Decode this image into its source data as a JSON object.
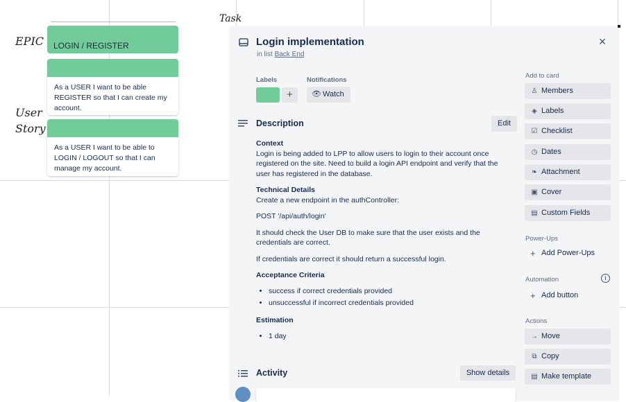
{
  "board": {
    "annotations": {
      "epic": "EPIC",
      "user_story_1": "User",
      "user_story_2": "Story",
      "task": "Task"
    },
    "epic_card": {
      "title": "LOGIN / REGISTER"
    },
    "story_cards": [
      {
        "text": "As a USER I want to be able REGISTER so that I can create my account."
      },
      {
        "text": "As a USER I want to be able to LOGIN / LOGOUT so that I can manage my account."
      }
    ]
  },
  "card": {
    "title": "Login implementation",
    "list_prefix": "in list",
    "list_name": "Back End",
    "labels_heading": "Labels",
    "notifications_heading": "Notifications",
    "add_label": "+",
    "watch_label": "Watch",
    "description_heading": "Description",
    "edit_label": "Edit",
    "description": {
      "context_heading": "Context",
      "context_text": "Login is being added to LPP to allow users to login to their account once registered on the site. Need to build a login API endpoint and verify that the user has registered in the database.",
      "technical_heading": "Technical Details",
      "technical_text": "Create a new endpoint in the authController:",
      "endpoint": "POST '/api/auth/login'",
      "check_text": "It should check the User DB to make sure that the user exists and the credentials are correct.",
      "success_text": "If credentials are correct it should return a successful login.",
      "acceptance_heading": "Acceptance Criteria",
      "acceptance_items": [
        "success if correct credentials provided",
        "unsuccessful if incorrect credentials provided"
      ],
      "estimation_heading": "Estimation",
      "estimation_items": [
        "1 day"
      ]
    },
    "activity_heading": "Activity",
    "show_details": "Show details",
    "close": "×"
  },
  "sidebar": {
    "add_to_card": "Add to card",
    "add_buttons": [
      {
        "label": "Members",
        "icon": "person-icon"
      },
      {
        "label": "Labels",
        "icon": "tag-icon"
      },
      {
        "label": "Checklist",
        "icon": "checkbox-icon"
      },
      {
        "label": "Dates",
        "icon": "clock-icon"
      },
      {
        "label": "Attachment",
        "icon": "paperclip-icon"
      },
      {
        "label": "Cover",
        "icon": "card-icon"
      },
      {
        "label": "Custom Fields",
        "icon": "fields-icon"
      }
    ],
    "powerups_heading": "Power-Ups",
    "add_powerups": "Add Power-Ups",
    "automation_heading": "Automation",
    "add_button": "Add button",
    "actions_heading": "Actions",
    "actions": [
      {
        "label": "Move",
        "icon": "arrow-right-icon"
      },
      {
        "label": "Copy",
        "icon": "copy-icon"
      },
      {
        "label": "Make template",
        "icon": "template-icon"
      }
    ]
  },
  "colors": {
    "label_green": "#72cc99",
    "modal_bg": "#f4f5f7",
    "button_bg": "#e4e6ea"
  }
}
